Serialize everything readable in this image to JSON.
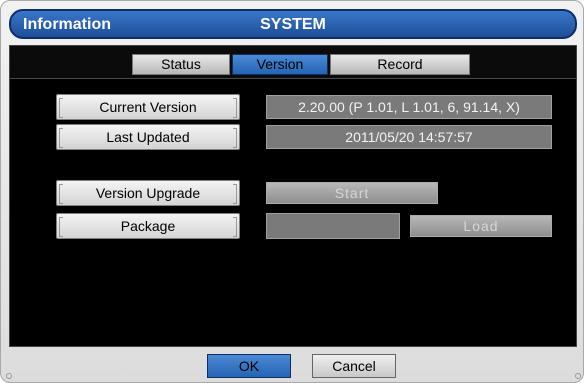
{
  "title": {
    "left": "Information",
    "center": "SYSTEM"
  },
  "tabs": [
    {
      "label": "Status",
      "active": false
    },
    {
      "label": "Version",
      "active": true
    },
    {
      "label": "Record",
      "active": false
    }
  ],
  "rows": {
    "current_version": {
      "label": "Current Version",
      "value": "2.20.00 (P 1.01, L 1.01, 6, 91.14, X)"
    },
    "last_updated": {
      "label": "Last Updated",
      "value": "2011/05/20  14:57:57"
    },
    "version_upgrade": {
      "label": "Version Upgrade",
      "button": "Start"
    },
    "package": {
      "label": "Package",
      "value": "",
      "button": "Load"
    }
  },
  "footer": {
    "ok": "OK",
    "cancel": "Cancel"
  },
  "colors": {
    "accent": "#2563b4",
    "panel": "#000000",
    "value_bg": "#7a7a7a"
  }
}
